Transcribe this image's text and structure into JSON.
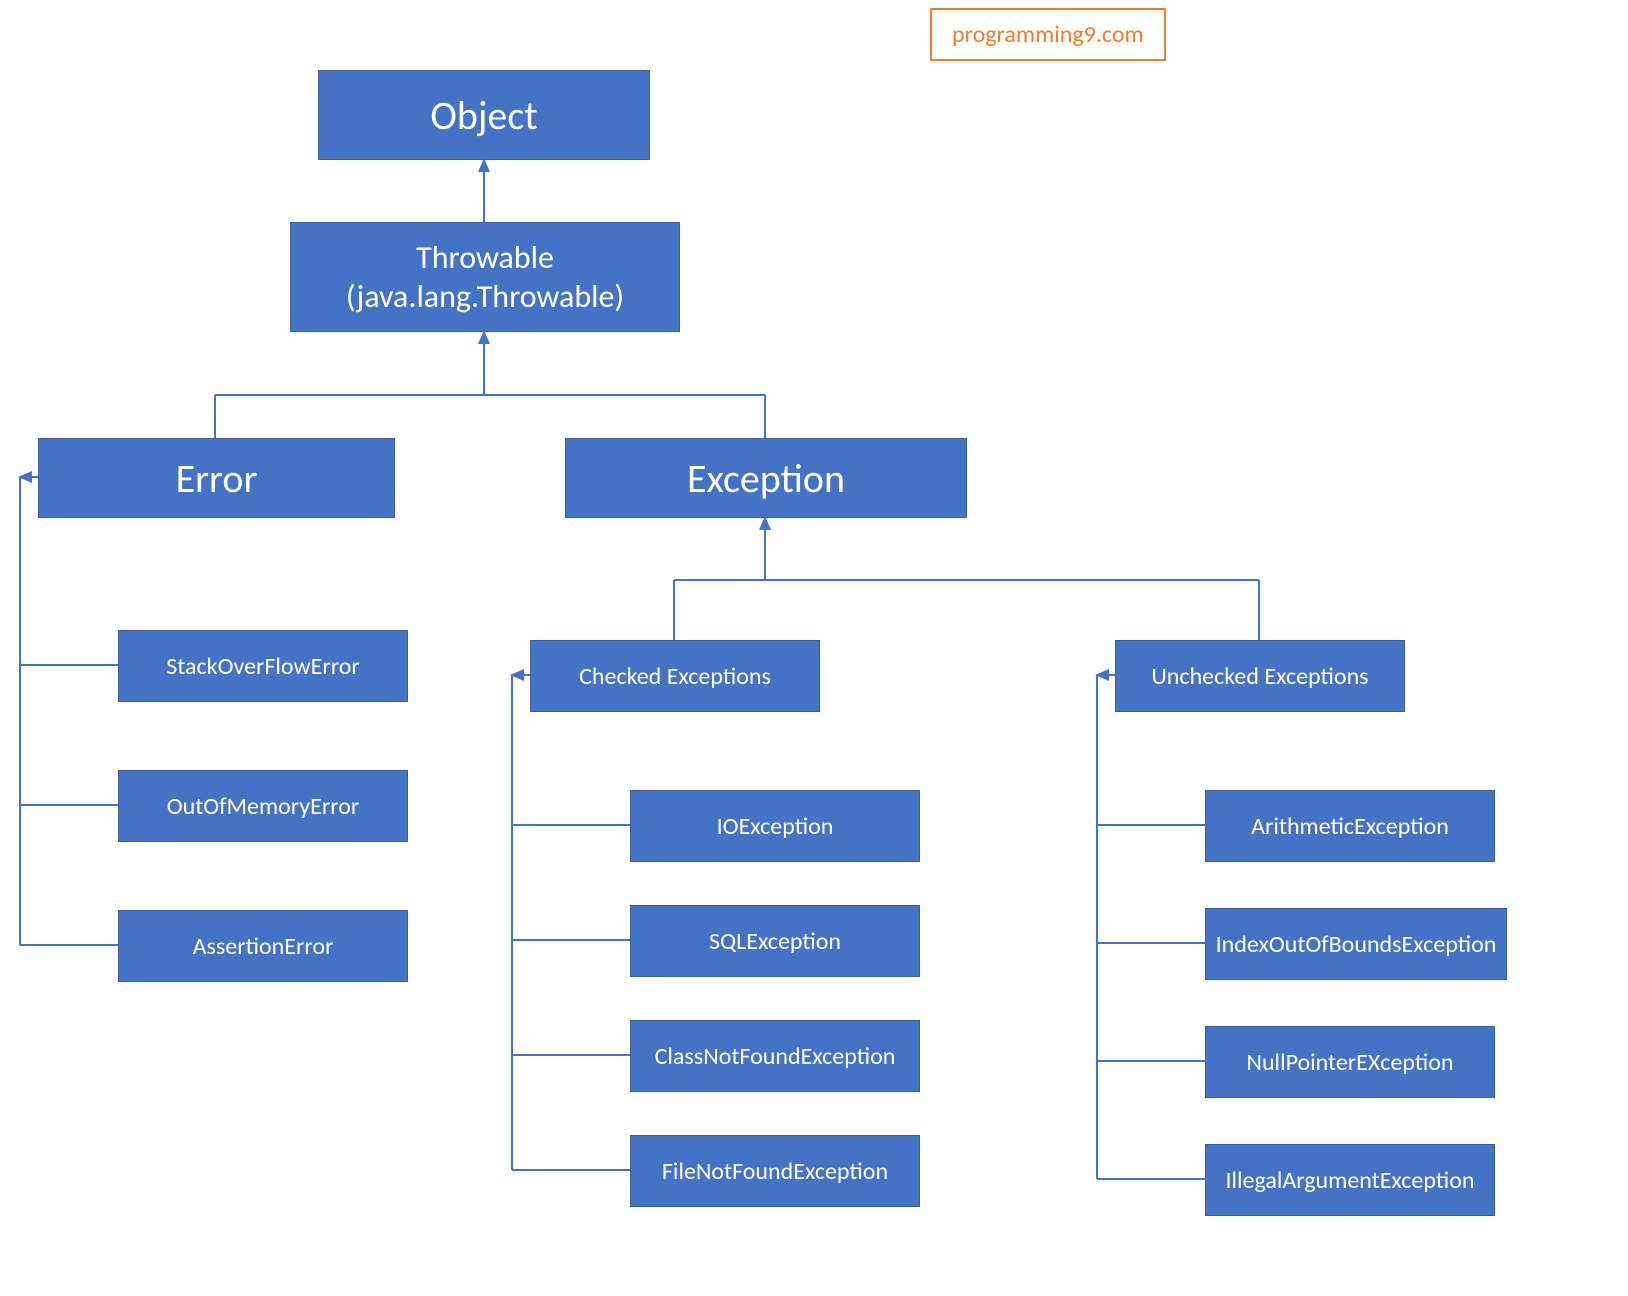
{
  "credit": "programming9.com",
  "object": "Object",
  "throwable": "Throwable\n(java.lang.Throwable)",
  "error": "Error",
  "exception": "Exception",
  "error_children": {
    "stackoverflow": "StackOverFlowError",
    "outofmemory": "OutOfMemoryError",
    "assertion": "AssertionError"
  },
  "checked": "Checked Exceptions",
  "unchecked": "Unchecked Exceptions",
  "checked_children": {
    "io": "IOException",
    "sql": "SQLException",
    "classnotfound": "ClassNotFoundException",
    "filenotfound": "FileNotFoundException"
  },
  "unchecked_children": {
    "arithmetic": "ArithmeticException",
    "indexoob": "IndexOutOfBoundsException",
    "nullpointer": "NullPointerEXception",
    "illegalarg": "IllegalArgumentException"
  }
}
